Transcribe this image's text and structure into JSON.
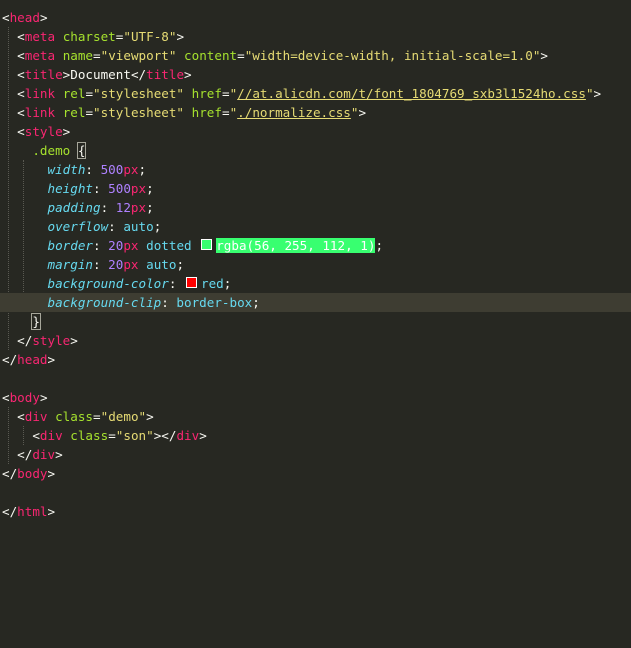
{
  "editor": {
    "theme": "monokai",
    "colors": {
      "background": "#272822",
      "current_line": "#3e3d32",
      "tag": "#f92672",
      "attribute": "#a6e22e",
      "string": "#e6db74",
      "property": "#66d9ef",
      "number": "#ae81ff",
      "swatch_green": "#38ff70",
      "swatch_red": "#ff0000"
    },
    "lines": [
      {
        "tokens": [
          [
            "punct",
            "<"
          ],
          [
            "tag",
            "head"
          ],
          [
            "punct",
            ">"
          ]
        ]
      },
      {
        "tokens": [
          [
            "punct",
            "  <"
          ],
          [
            "tag",
            "meta"
          ],
          [
            "punct",
            " "
          ],
          [
            "attr",
            "charset"
          ],
          [
            "punct",
            "="
          ],
          [
            "str",
            "\"UTF-8\""
          ],
          [
            "punct",
            ">"
          ]
        ]
      },
      {
        "tokens": [
          [
            "punct",
            "  <"
          ],
          [
            "tag",
            "meta"
          ],
          [
            "punct",
            " "
          ],
          [
            "attr",
            "name"
          ],
          [
            "punct",
            "="
          ],
          [
            "str",
            "\"viewport\""
          ],
          [
            "punct",
            " "
          ],
          [
            "attr",
            "content"
          ],
          [
            "punct",
            "="
          ],
          [
            "str",
            "\"width=device-width, initial-scale=1.0\""
          ],
          [
            "punct",
            ">"
          ]
        ]
      },
      {
        "tokens": [
          [
            "punct",
            "  <"
          ],
          [
            "tag",
            "title"
          ],
          [
            "punct",
            ">"
          ],
          [
            "text",
            "Document"
          ],
          [
            "punct",
            "</"
          ],
          [
            "tag",
            "title"
          ],
          [
            "punct",
            ">"
          ]
        ]
      },
      {
        "tokens": [
          [
            "punct",
            "  <"
          ],
          [
            "tag",
            "link"
          ],
          [
            "punct",
            " "
          ],
          [
            "attr",
            "rel"
          ],
          [
            "punct",
            "="
          ],
          [
            "str",
            "\"stylesheet\""
          ],
          [
            "punct",
            " "
          ],
          [
            "attr",
            "href"
          ],
          [
            "punct",
            "="
          ],
          [
            "str",
            "\""
          ],
          [
            "strlink",
            "//at.alicdn.com/t/font_1804769_sxb3l1524ho.css"
          ],
          [
            "str",
            "\""
          ],
          [
            "punct",
            ">"
          ]
        ]
      },
      {
        "tokens": [
          [
            "punct",
            "  <"
          ],
          [
            "tag",
            "link"
          ],
          [
            "punct",
            " "
          ],
          [
            "attr",
            "rel"
          ],
          [
            "punct",
            "="
          ],
          [
            "str",
            "\"stylesheet\""
          ],
          [
            "punct",
            " "
          ],
          [
            "attr",
            "href"
          ],
          [
            "punct",
            "="
          ],
          [
            "str",
            "\""
          ],
          [
            "strlink",
            "./normalize.css"
          ],
          [
            "str",
            "\""
          ],
          [
            "punct",
            ">"
          ]
        ]
      },
      {
        "tokens": [
          [
            "punct",
            "  <"
          ],
          [
            "tag",
            "style"
          ],
          [
            "punct",
            ">"
          ]
        ]
      },
      {
        "tokens": [
          [
            "punct",
            "    "
          ],
          [
            "sel",
            ".demo"
          ],
          [
            "punct",
            " "
          ],
          [
            "brace-hl",
            "{"
          ]
        ]
      },
      {
        "tokens": [
          [
            "punct",
            "      "
          ],
          [
            "prop",
            "width"
          ],
          [
            "punct",
            ": "
          ],
          [
            "num",
            "500"
          ],
          [
            "unit",
            "px"
          ],
          [
            "punct",
            ";"
          ]
        ]
      },
      {
        "tokens": [
          [
            "punct",
            "      "
          ],
          [
            "prop",
            "height"
          ],
          [
            "punct",
            ": "
          ],
          [
            "num",
            "500"
          ],
          [
            "unit",
            "px"
          ],
          [
            "punct",
            ";"
          ]
        ]
      },
      {
        "tokens": [
          [
            "punct",
            "      "
          ],
          [
            "prop",
            "padding"
          ],
          [
            "punct",
            ": "
          ],
          [
            "num",
            "12"
          ],
          [
            "unit",
            "px"
          ],
          [
            "punct",
            ";"
          ]
        ]
      },
      {
        "tokens": [
          [
            "punct",
            "      "
          ],
          [
            "prop",
            "overflow"
          ],
          [
            "punct",
            ": "
          ],
          [
            "val",
            "auto"
          ],
          [
            "punct",
            ";"
          ]
        ]
      },
      {
        "tokens": [
          [
            "punct",
            "      "
          ],
          [
            "prop",
            "border"
          ],
          [
            "punct",
            ": "
          ],
          [
            "num",
            "20"
          ],
          [
            "unit",
            "px"
          ],
          [
            "punct",
            " "
          ],
          [
            "val",
            "dotted"
          ],
          [
            "punct",
            " "
          ],
          [
            "swatch-green",
            ""
          ],
          [
            "rgba-hl",
            "rgba(56, 255, 112, 1)"
          ],
          [
            "punct",
            ";"
          ]
        ]
      },
      {
        "tokens": [
          [
            "punct",
            "      "
          ],
          [
            "prop",
            "margin"
          ],
          [
            "punct",
            ": "
          ],
          [
            "num",
            "20"
          ],
          [
            "unit",
            "px"
          ],
          [
            "punct",
            " "
          ],
          [
            "val",
            "auto"
          ],
          [
            "punct",
            ";"
          ]
        ]
      },
      {
        "tokens": [
          [
            "punct",
            "      "
          ],
          [
            "prop",
            "background-color"
          ],
          [
            "punct",
            ": "
          ],
          [
            "swatch-red",
            ""
          ],
          [
            "val",
            "red"
          ],
          [
            "punct",
            ";"
          ]
        ]
      },
      {
        "tokens": [
          [
            "punct",
            "      "
          ],
          [
            "prop",
            "background-clip"
          ],
          [
            "punct",
            ": "
          ],
          [
            "val",
            "border-box"
          ],
          [
            "punct",
            ";"
          ]
        ],
        "current": true
      },
      {
        "tokens": [
          [
            "punct",
            "    "
          ],
          [
            "brace-hl",
            "}"
          ]
        ]
      },
      {
        "tokens": [
          [
            "punct",
            "  </"
          ],
          [
            "tag",
            "style"
          ],
          [
            "punct",
            ">"
          ]
        ]
      },
      {
        "tokens": [
          [
            "punct",
            "</"
          ],
          [
            "tag",
            "head"
          ],
          [
            "punct",
            ">"
          ]
        ]
      },
      {
        "tokens": []
      },
      {
        "tokens": [
          [
            "punct",
            "<"
          ],
          [
            "tag",
            "body"
          ],
          [
            "punct",
            ">"
          ]
        ]
      },
      {
        "tokens": [
          [
            "punct",
            "  <"
          ],
          [
            "tag",
            "div"
          ],
          [
            "punct",
            " "
          ],
          [
            "attr",
            "class"
          ],
          [
            "punct",
            "="
          ],
          [
            "str",
            "\"demo\""
          ],
          [
            "punct",
            ">"
          ]
        ]
      },
      {
        "tokens": [
          [
            "punct",
            "    <"
          ],
          [
            "tag",
            "div"
          ],
          [
            "punct",
            " "
          ],
          [
            "attr",
            "class"
          ],
          [
            "punct",
            "="
          ],
          [
            "str",
            "\"son\""
          ],
          [
            "punct",
            "></"
          ],
          [
            "tag",
            "div"
          ],
          [
            "punct",
            ">"
          ]
        ]
      },
      {
        "tokens": [
          [
            "punct",
            "  </"
          ],
          [
            "tag",
            "div"
          ],
          [
            "punct",
            ">"
          ]
        ]
      },
      {
        "tokens": [
          [
            "punct",
            "</"
          ],
          [
            "tag",
            "body"
          ],
          [
            "punct",
            ">"
          ]
        ]
      },
      {
        "tokens": []
      },
      {
        "tokens": [
          [
            "punct",
            "</"
          ],
          [
            "tag",
            "html"
          ],
          [
            "punct",
            ">"
          ]
        ]
      }
    ]
  }
}
